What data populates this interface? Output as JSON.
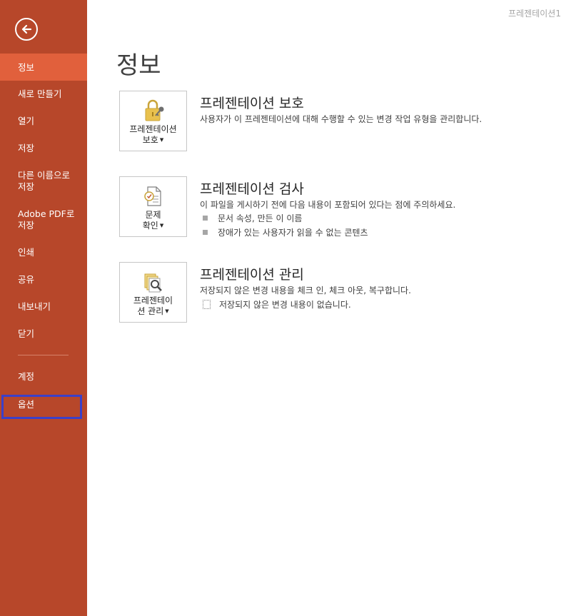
{
  "window": {
    "doc_title": "프레젠테이션1"
  },
  "sidebar": {
    "back_icon": "back-arrow-icon",
    "items": [
      {
        "label": "정보",
        "active": true
      },
      {
        "label": "새로 만들기"
      },
      {
        "label": "열기"
      },
      {
        "label": "저장"
      },
      {
        "label": "다른 이름으로\n저장"
      },
      {
        "label": "Adobe PDF로\n저장"
      },
      {
        "label": "인쇄"
      },
      {
        "label": "공유"
      },
      {
        "label": "내보내기"
      },
      {
        "label": "닫기"
      },
      {
        "label": "계정"
      },
      {
        "label": "옵션"
      }
    ],
    "colors": {
      "background": "#b7472a",
      "active": "#e1603c",
      "highlight": "#3b40c8"
    }
  },
  "main": {
    "title": "정보",
    "sections": [
      {
        "tile_label_1": "프레젠테이션",
        "tile_label_2": "보호",
        "tile_icon": "lock-key-icon",
        "heading": "프레젠테이션 보호",
        "description": "사용자가 이 프레젠테이션에 대해 수행할 수 있는 변경 작업 유형을 관리합니다."
      },
      {
        "tile_label_1": "문제",
        "tile_label_2": "확인",
        "tile_icon": "inspect-document-icon",
        "heading": "프레젠테이션 검사",
        "description": "이 파일을 게시하기 전에 다음 내용이 포함되어 있다는 점에 주의하세요.",
        "bullets": [
          "문서 속성, 만든 이 이름",
          "장애가 있는 사용자가 읽을 수 없는 콘텐츠"
        ]
      },
      {
        "tile_label_1": "프레젠테이",
        "tile_label_2": "션 관리",
        "tile_icon": "manage-versions-icon",
        "heading": "프레젠테이션 관리",
        "description": "저장되지 않은 변경 내용을 체크 인, 체크 아웃, 복구합니다.",
        "note": "저장되지 않은 변경 내용이 없습니다."
      }
    ]
  }
}
